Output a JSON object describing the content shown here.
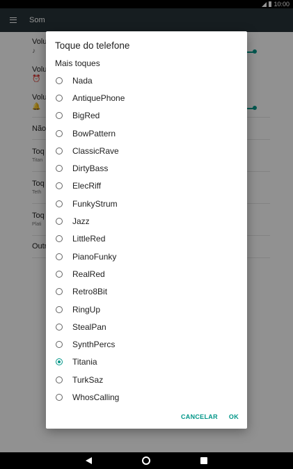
{
  "status_bar": {
    "time": "10:00"
  },
  "app_bar": {
    "title": "Som"
  },
  "settings": {
    "items": [
      {
        "label": "Volu",
        "sub": ""
      },
      {
        "label": "Volu",
        "sub": ""
      },
      {
        "label": "Volu",
        "sub": ""
      },
      {
        "label": "Não",
        "sub": ""
      },
      {
        "label": "Toq",
        "sub": "Titan"
      },
      {
        "label": "Toq",
        "sub": "Teth"
      },
      {
        "label": "Toq",
        "sub": "Plati"
      },
      {
        "label": "Outr",
        "sub": ""
      }
    ]
  },
  "dialog": {
    "title": "Toque do telefone",
    "subtitle": "Mais toques",
    "options": [
      {
        "label": "Nada",
        "checked": false
      },
      {
        "label": "AntiquePhone",
        "checked": false
      },
      {
        "label": "BigRed",
        "checked": false
      },
      {
        "label": "BowPattern",
        "checked": false
      },
      {
        "label": "ClassicRave",
        "checked": false
      },
      {
        "label": "DirtyBass",
        "checked": false
      },
      {
        "label": "ElecRiff",
        "checked": false
      },
      {
        "label": "FunkyStrum",
        "checked": false
      },
      {
        "label": "Jazz",
        "checked": false
      },
      {
        "label": "LittleRed",
        "checked": false
      },
      {
        "label": "PianoFunky",
        "checked": false
      },
      {
        "label": "RealRed",
        "checked": false
      },
      {
        "label": "Retro8Bit",
        "checked": false
      },
      {
        "label": "RingUp",
        "checked": false
      },
      {
        "label": "StealPan",
        "checked": false
      },
      {
        "label": "SynthPercs",
        "checked": false
      },
      {
        "label": "Titania",
        "checked": true
      },
      {
        "label": "TurkSaz",
        "checked": false
      },
      {
        "label": "WhosCalling",
        "checked": false
      }
    ],
    "cancel_label": "CANCELAR",
    "ok_label": "OK"
  },
  "colors": {
    "accent": "#009688",
    "app_bar": "#263238"
  },
  "icons": {
    "menu": "menu-icon",
    "music": "music-note-icon",
    "alarm": "alarm-icon",
    "bell": "bell-icon"
  }
}
